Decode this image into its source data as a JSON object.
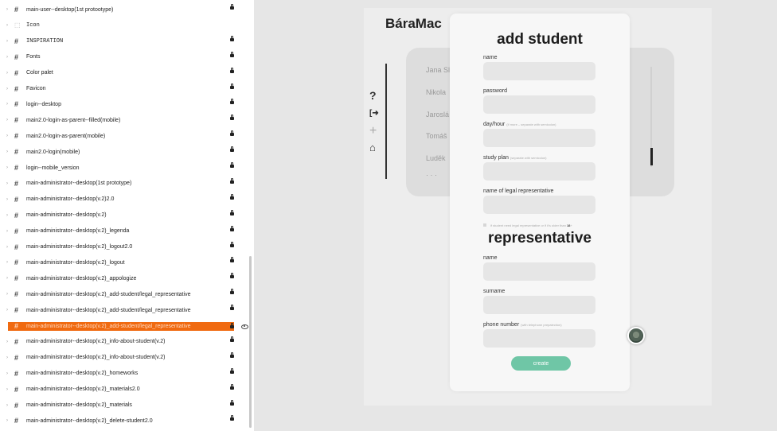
{
  "layers": {
    "items": [
      {
        "type": "#",
        "label": "main-user--desktop(1st protootype)"
      },
      {
        "type": "component",
        "label": "Icon"
      },
      {
        "type": "#",
        "label": "INSPIRATION"
      },
      {
        "type": "#",
        "label": "Fonts"
      },
      {
        "type": "#",
        "label": "Color palet"
      },
      {
        "type": "#",
        "label": "Favicon"
      },
      {
        "type": "#",
        "label": "login--desktop"
      },
      {
        "type": "#",
        "label": "main2.0-login-as-parent--filled(mobile)"
      },
      {
        "type": "#",
        "label": "main2.0-login-as-parent(mobile)"
      },
      {
        "type": "#",
        "label": "main2.0-login(mobile)"
      },
      {
        "type": "#",
        "label": "login--mobile_version"
      },
      {
        "type": "#",
        "label": "main-administrator--desktop(1st prototype)"
      },
      {
        "type": "#",
        "label": "main-administrator--desktop(v.2)2.0"
      },
      {
        "type": "#",
        "label": "main-administrator--desktop(v.2)"
      },
      {
        "type": "#",
        "label": "main-administrator--desktop(v.2)_legenda"
      },
      {
        "type": "#",
        "label": "main-administrator--desktop(v.2)_logout2.0"
      },
      {
        "type": "#",
        "label": "main-administrator--desktop(v.2)_logout"
      },
      {
        "type": "#",
        "label": "main-administrator--desktop(v.2)_appologize"
      },
      {
        "type": "#",
        "label": "main-administrator--desktop(v.2)_add-student/legal_representative"
      },
      {
        "type": "#",
        "label": "main-administrator--desktop(v.2)_add-student/legal_representative"
      },
      {
        "type": "#",
        "label": "main-administrator--desktop(v.2)_add-student/legal_representative",
        "selected": true
      },
      {
        "type": "#",
        "label": "main-administrator--desktop(v.2)_info-about-student(v.2)"
      },
      {
        "type": "#",
        "label": "main-administrator--desktop(v.2)_info-about-student(v.2)"
      },
      {
        "type": "#",
        "label": "main-administrator--desktop(v.2)_homeworks"
      },
      {
        "type": "#",
        "label": "main-administrator--desktop(v.2)_materials2.0"
      },
      {
        "type": "#",
        "label": "main-administrator--desktop(v.2)_materials"
      },
      {
        "type": "#",
        "label": "main-administrator--desktop(v.2)_delete-student2.0"
      }
    ]
  },
  "canvas": {
    "brand": "BáraMac",
    "sidebar_icons": [
      "?",
      "[➜",
      "+",
      "⌂"
    ],
    "student_names": [
      "Jana Sl",
      "Nikola",
      "Jaroslá",
      "Tomáš",
      "Luděk"
    ],
    "more": "· · ·"
  },
  "modal": {
    "title": "add student",
    "fields": {
      "name": "name",
      "password": "password",
      "dayhour": "day/hour",
      "dayhour_hint": "(if more – separate with semicolon)",
      "study_plan": "study plan",
      "study_plan_hint": "(separate with semicolon)",
      "legal_rep": "name of legal representative"
    },
    "checkbox_label": "if student need legal representative or if it's older than",
    "checkbox_age": "18",
    "checkbox_suffix": "+",
    "rep_title": "representative",
    "rep_fields": {
      "name": "name",
      "surname": "surname",
      "phone": "phone number",
      "phone_hint": "(with telephone prepalection)"
    },
    "create_label": "create"
  },
  "colors": {
    "selected_layer": "#f06a10",
    "create_button": "#6fc6a6"
  }
}
